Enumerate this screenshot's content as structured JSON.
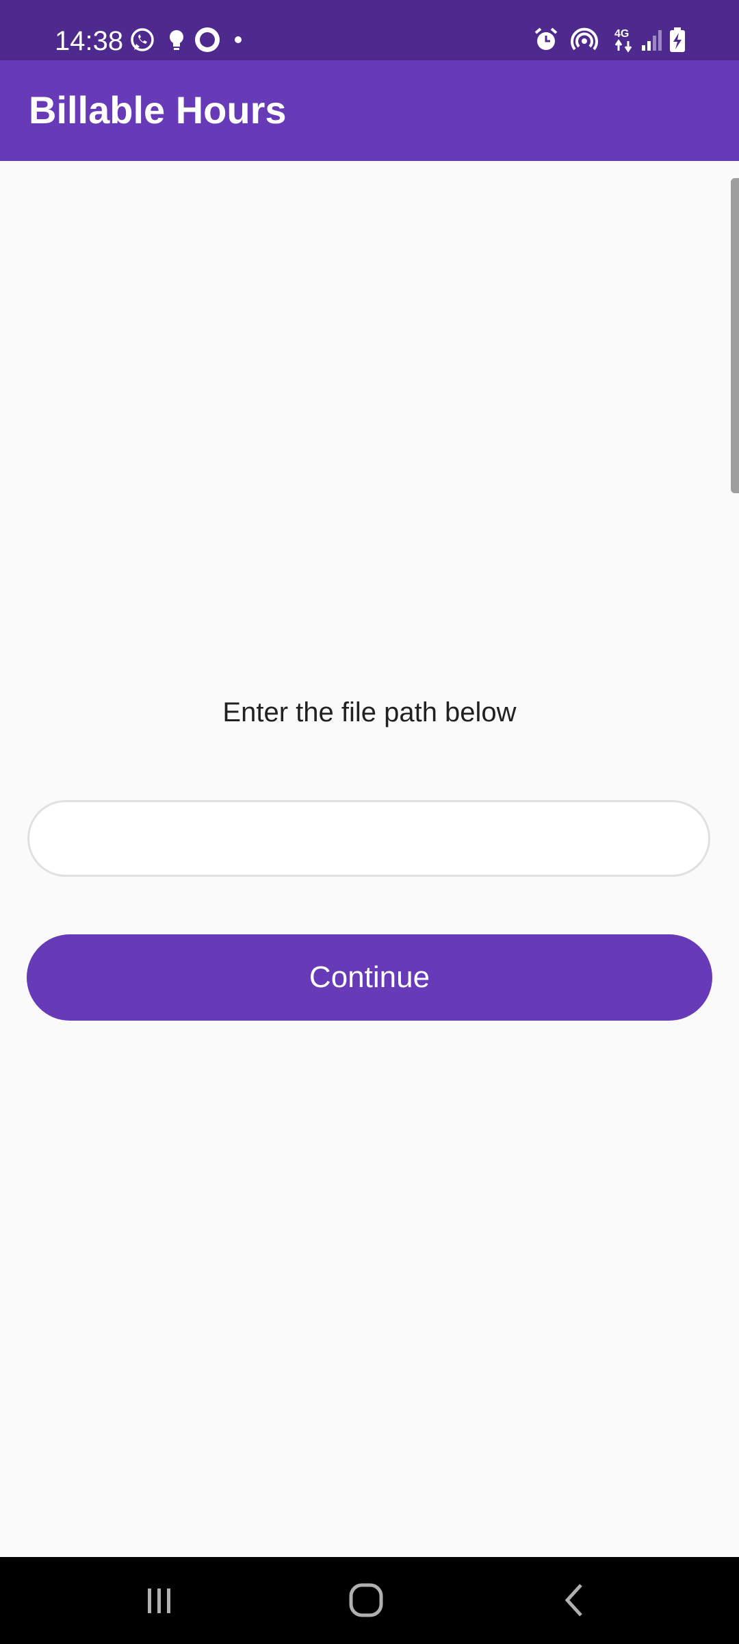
{
  "status_bar": {
    "time": "14:38",
    "left_icons": [
      "whatsapp-icon",
      "lightbulb-icon",
      "chelsea-badge-icon",
      "dot-icon"
    ],
    "right_icons": [
      "alarm-icon",
      "hotspot-icon",
      "4g-data-icon",
      "signal-icon",
      "battery-charging-icon"
    ],
    "network_label": "4G"
  },
  "app_bar": {
    "title": "Billable Hours",
    "color": "#673ab7"
  },
  "main": {
    "prompt": "Enter the file path below",
    "file_path_input": {
      "value": "",
      "placeholder": ""
    },
    "continue_label": "Continue",
    "accent_color": "#673ab7"
  },
  "nav_bar": {
    "buttons": [
      "recent-apps-icon",
      "home-icon",
      "back-icon"
    ]
  }
}
